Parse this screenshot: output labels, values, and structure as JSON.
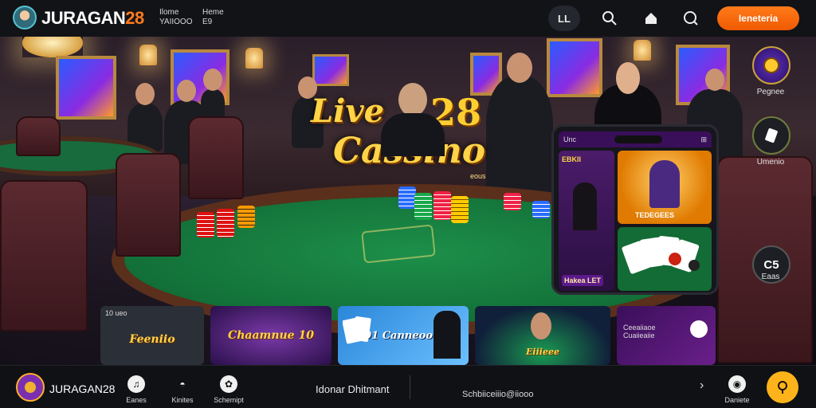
{
  "header": {
    "brand": "JURAGAN",
    "brand_num": "28",
    "meta1_line1": "Ilome",
    "meta1_line2": "YAIIOOO",
    "meta2_line1": "Heme",
    "meta2_line2": "E9",
    "icon_box_label": "LL",
    "cta_label": "Ieneteria"
  },
  "hero": {
    "title_word1": "Live",
    "title_num": "28",
    "title_word2": "Cassino",
    "title_tag": "eous"
  },
  "side_buttons": [
    {
      "label": "Pegnee",
      "icon": "coin-icon"
    },
    {
      "label": "Umenio",
      "icon": "card-icon"
    },
    {
      "label": "Eaas",
      "icon": "chat-icon",
      "glyph": "C5"
    }
  ],
  "phone": {
    "top_left": "Unc",
    "top_right": "⊞",
    "left_caption": "EBKII",
    "bottom_left": "Hakea LET",
    "center_caption": "TEDEGEES"
  },
  "cards": [
    {
      "small": "10 ueo",
      "caption": "Feeniio"
    },
    {
      "small": "",
      "caption": "Chaamnue 10"
    },
    {
      "small": "",
      "caption": "0001 Canneoo"
    },
    {
      "small": "",
      "caption": "Eiiieee"
    },
    {
      "small": "Ceeaiiaoe Cuaiieaiie",
      "caption": ""
    }
  ],
  "footer": {
    "brand": "JURAGAN28",
    "nav": [
      {
        "label": "Eanes",
        "icon": "music-icon"
      },
      {
        "label": "Kinites",
        "icon": "cap-icon"
      },
      {
        "label": "Schemipt",
        "icon": "ball-icon"
      }
    ],
    "center_text": "Idonar Dhitmant",
    "code_text": "Schbiiceiiio@iiooo",
    "right_label": "Daniete",
    "fab_icon": "pin-icon"
  }
}
